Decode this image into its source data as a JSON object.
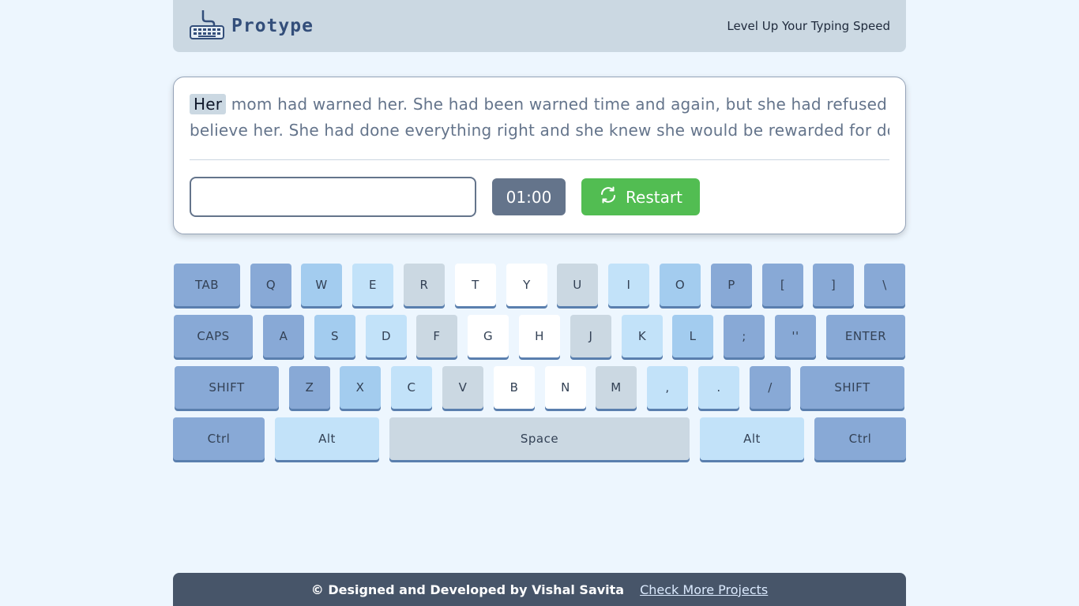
{
  "header": {
    "brand": "Protype",
    "tagline": "Level Up Your Typing Speed",
    "logo_icon": "keyboard-icon"
  },
  "passage": {
    "current_word": "Her",
    "line1_rest": "mom had warned her. She had been warned time and again, but she had refused to",
    "line2": "believe her. She had done everything right and she knew she would be rewarded for doing"
  },
  "controls": {
    "input_value": "",
    "input_placeholder": "",
    "timer": "01:00",
    "restart_label": "Restart",
    "restart_icon": "refresh-icon"
  },
  "keyboard": {
    "rows": [
      [
        "TAB",
        "Q",
        "W",
        "E",
        "R",
        "T",
        "Y",
        "U",
        "I",
        "O",
        "P",
        "[",
        "]",
        "\\"
      ],
      [
        "CAPS",
        "A",
        "S",
        "D",
        "F",
        "G",
        "H",
        "J",
        "K",
        "L",
        ";",
        "''",
        "ENTER"
      ],
      [
        "SHIFT",
        "Z",
        "X",
        "C",
        "V",
        "B",
        "N",
        "M",
        ",",
        ".",
        "/",
        "SHIFT"
      ],
      [
        "Ctrl",
        "Alt",
        "Space",
        "Alt",
        "Ctrl"
      ]
    ],
    "colors": {
      "c1": "#88a9d6",
      "c2": "#a3ccef",
      "c3": "#c2e2f9",
      "c4": "#cbd8e2",
      "c5": "#ffffff"
    }
  },
  "footer": {
    "credit": "© Designed and Developed by Vishal Savita",
    "link": "Check More Projects"
  }
}
